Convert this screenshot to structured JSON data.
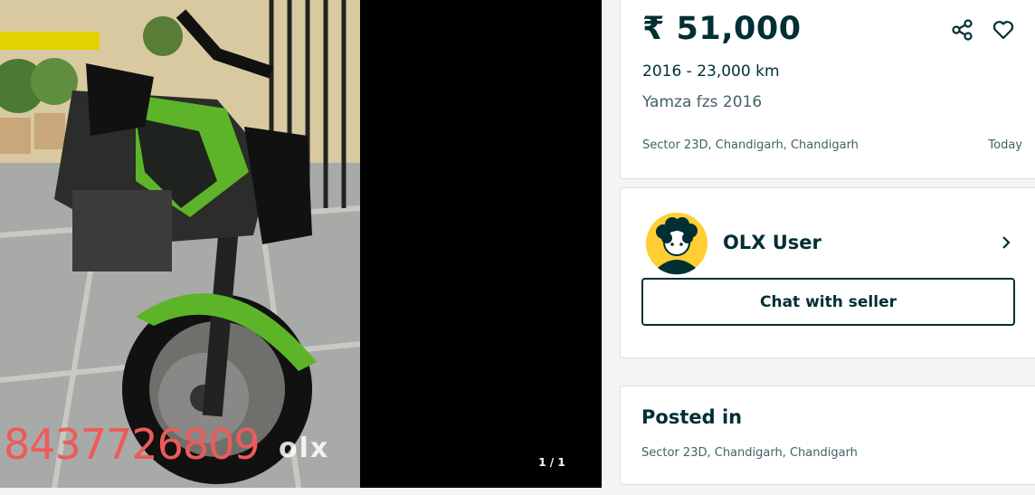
{
  "gallery": {
    "counter": "1 / 1",
    "photo_overlay": {
      "phone_watermark": "8437726809",
      "brand_watermark": "olx"
    }
  },
  "listing": {
    "price": "₹ 51,000",
    "year_km": "2016 - 23,000 km",
    "title": "Yamza fzs 2016",
    "location": "Sector 23D, Chandigarh, Chandigarh",
    "date": "Today",
    "icons": {
      "share": "share-icon",
      "favorite": "heart-icon"
    }
  },
  "seller": {
    "name": "OLX User",
    "chat_label": "Chat with seller",
    "icons": {
      "avatar": "avatar",
      "chevron": "chevron-right-icon"
    }
  },
  "posted": {
    "heading": "Posted in",
    "location": "Sector 23D, Chandigarh, Chandigarh"
  },
  "colors": {
    "primary": "#002f34",
    "secondary_text": "#406367",
    "avatar_bg": "#ffce32",
    "page_bg": "#f2f4f5"
  }
}
